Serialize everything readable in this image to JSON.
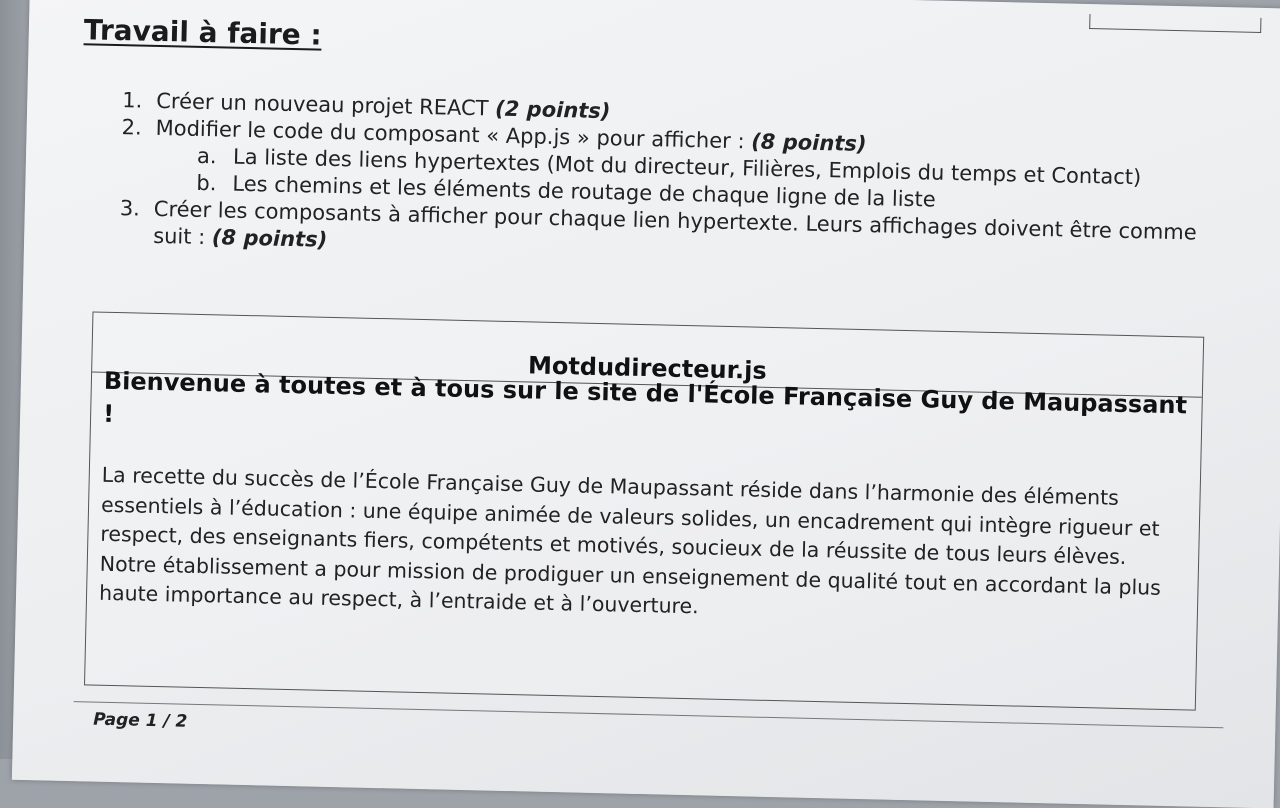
{
  "heading": "Travail à faire :",
  "tasks": [
    {
      "num": "1.",
      "text": "Créer un nouveau projet REACT ",
      "points": "(2 points)"
    },
    {
      "num": "2.",
      "text": "Modifier le code du composant « App.js » pour afficher : ",
      "points": "(8 points)"
    },
    {
      "num": "3.",
      "text": "Créer les composants à afficher pour chaque lien hypertexte. Leurs affichages doivent être comme suit : ",
      "points": "(8 points)"
    }
  ],
  "subtasks": [
    {
      "num": "a.",
      "text": "La liste des liens hypertextes (Mot du directeur, Filières, Emplois du temps et Contact)"
    },
    {
      "num": "b.",
      "text": "Les chemins et les éléments de routage de chaque ligne de la liste"
    }
  ],
  "figure": {
    "title": "Motdudirecteur.js",
    "heading": "Bienvenue à toutes et à tous sur le site de l'École Française Guy de Maupassant !",
    "body": "La recette du succès de l’École Française Guy de Maupassant réside dans l’harmonie des éléments essentiels à l’éducation : une équipe animée de valeurs solides, un encadrement qui intègre rigueur et respect, des enseignants fiers, compétents et motivés, soucieux de la réussite de tous leurs élèves. Notre établissement a pour mission de prodiguer un enseignement de qualité tout en accordant la plus haute importance au respect, à l’entraide et à l’ouverture."
  },
  "footer": "Page 1 / 2"
}
